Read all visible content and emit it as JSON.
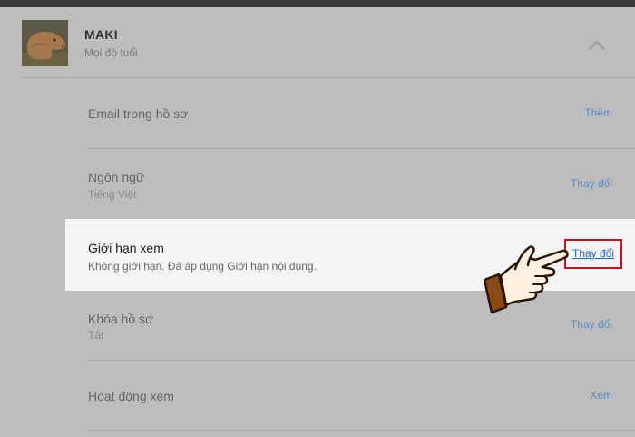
{
  "profile": {
    "name": "MAKI",
    "maturity": "Mọi độ tuổi"
  },
  "rows": [
    {
      "title": "Email trong hồ sơ",
      "subtitle": "",
      "action": "Thêm"
    },
    {
      "title": "Ngôn ngữ",
      "subtitle": "Tiếng Việt",
      "action": "Thay đổi"
    },
    {
      "title": "Giới hạn xem",
      "subtitle": "Không giới hạn. Đã áp dụng Giới hạn nội dung.",
      "action": "Thay đổi"
    },
    {
      "title": "Khóa hồ sơ",
      "subtitle": "Tắt",
      "action": "Thay đổi"
    },
    {
      "title": "Hoạt động xem",
      "subtitle": "",
      "action": "Xem"
    }
  ],
  "colors": {
    "overlay": "#bdbdbd",
    "link": "#5b8cc7",
    "active_link": "#1c64c6",
    "highlight_border": "#c8101e"
  },
  "icons": [
    "chevron-up-icon",
    "pointing-hand-icon"
  ]
}
